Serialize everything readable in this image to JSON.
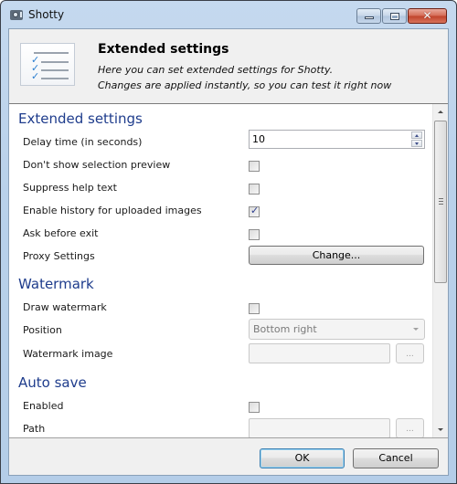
{
  "window": {
    "title": "Shotty",
    "app_icon": "camera-icon",
    "controls": {
      "minimize": "minimize-icon",
      "maximize": "maximize-icon",
      "close": "close-icon",
      "close_glyph": "✕"
    }
  },
  "header": {
    "icon": "checklist-icon",
    "title": "Extended settings",
    "description_line1": "Here you can set extended settings for Shotty.",
    "description_line2": "Changes are applied instantly, so you can test it right now"
  },
  "sections": {
    "extended": {
      "title": "Extended settings",
      "delay": {
        "label": "Delay time (in seconds)",
        "value": "10"
      },
      "no_preview": {
        "label": "Don't show selection preview",
        "checked": false
      },
      "suppress_help": {
        "label": "Suppress help text",
        "checked": false
      },
      "history": {
        "label": "Enable history for uploaded images",
        "checked": true
      },
      "ask_exit": {
        "label": "Ask before exit",
        "checked": false
      },
      "proxy": {
        "label": "Proxy Settings",
        "button": "Change..."
      }
    },
    "watermark": {
      "title": "Watermark",
      "draw": {
        "label": "Draw watermark",
        "checked": false
      },
      "position": {
        "label": "Position",
        "selected": "Bottom right",
        "enabled": false
      },
      "image": {
        "label": "Watermark image",
        "value": "",
        "browse": "..."
      }
    },
    "autosave": {
      "title": "Auto save",
      "enabled": {
        "label": "Enabled",
        "checked": false
      },
      "path": {
        "label": "Path",
        "value": "",
        "browse": "..."
      }
    }
  },
  "checkmark_glyph": "✓",
  "footer": {
    "ok": "OK",
    "cancel": "Cancel"
  },
  "colors": {
    "section_title": "#1e3c8c",
    "checkmark": "#2c3d8e",
    "close_button": "#c0422b",
    "default_button_border": "#3c7fb1"
  }
}
